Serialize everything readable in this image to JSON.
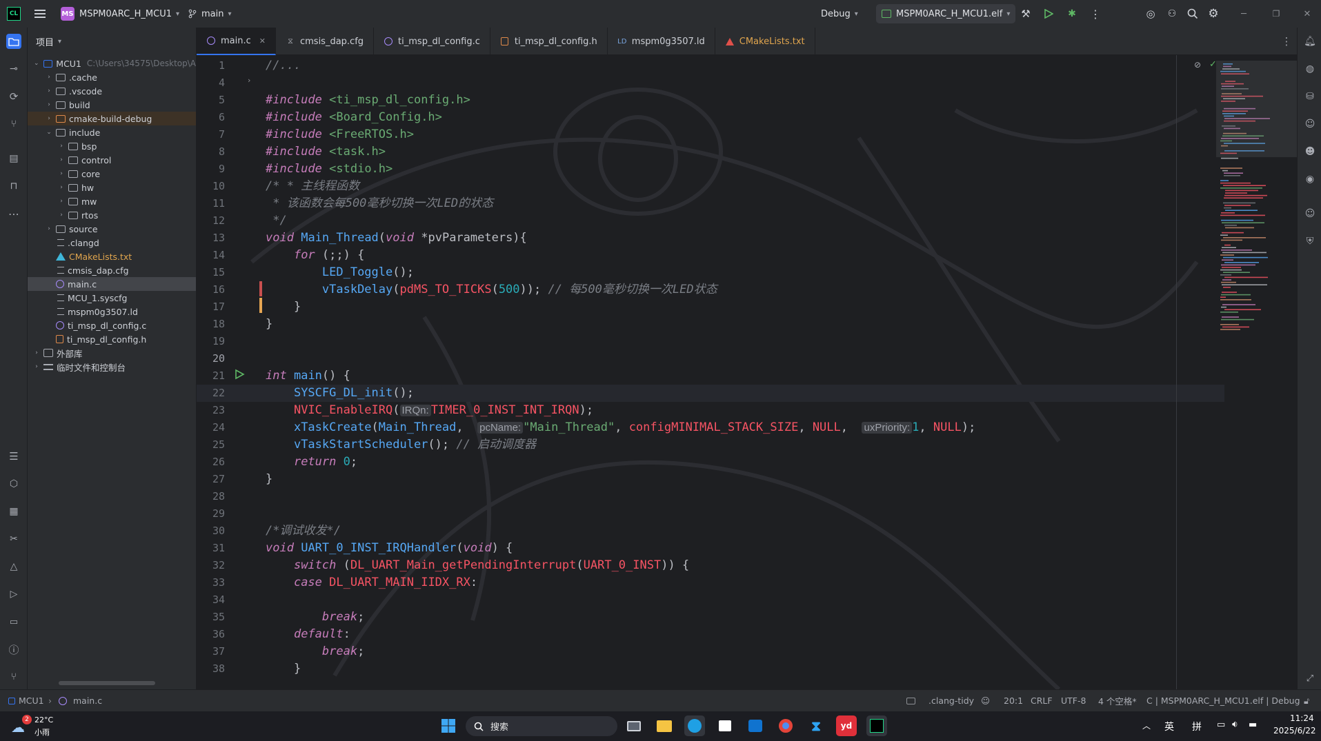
{
  "titlebar": {
    "project_badge": "MS",
    "project_name": "MSPM0ARC_H_MCU1",
    "branch": "main",
    "config": "Debug",
    "run_target": "MSPM0ARC_H_MCU1.elf"
  },
  "project_panel": {
    "title": "项目",
    "root_name": "MCU1",
    "root_path": "C:\\Users\\34575\\Desktop\\A",
    "items": [
      {
        "label": ".cache",
        "type": "folder",
        "depth": 1
      },
      {
        "label": ".vscode",
        "type": "folder",
        "depth": 1
      },
      {
        "label": "build",
        "type": "folder",
        "depth": 1
      },
      {
        "label": "cmake-build-debug",
        "type": "folder",
        "depth": 1
      },
      {
        "label": "include",
        "type": "folder",
        "depth": 1,
        "expanded": true
      },
      {
        "label": "bsp",
        "type": "folder",
        "depth": 2
      },
      {
        "label": "control",
        "type": "folder",
        "depth": 2
      },
      {
        "label": "core",
        "type": "folder",
        "depth": 2
      },
      {
        "label": "hw",
        "type": "folder",
        "depth": 2
      },
      {
        "label": "mw",
        "type": "folder",
        "depth": 2
      },
      {
        "label": "rtos",
        "type": "folder",
        "depth": 2
      },
      {
        "label": "source",
        "type": "folder",
        "depth": 1
      },
      {
        "label": ".clangd",
        "type": "file",
        "depth": 1
      },
      {
        "label": "CMakeLists.txt",
        "type": "cmake",
        "depth": 1
      },
      {
        "label": "cmsis_dap.cfg",
        "type": "file",
        "depth": 1
      },
      {
        "label": "main.c",
        "type": "c",
        "depth": 1
      },
      {
        "label": "MCU_1.syscfg",
        "type": "file",
        "depth": 1
      },
      {
        "label": "mspm0g3507.ld",
        "type": "file",
        "depth": 1
      },
      {
        "label": "ti_msp_dl_config.c",
        "type": "c",
        "depth": 1
      },
      {
        "label": "ti_msp_dl_config.h",
        "type": "h",
        "depth": 1
      },
      {
        "label": "外部库",
        "type": "lib",
        "depth": 0
      },
      {
        "label": "临时文件和控制台",
        "type": "scratch",
        "depth": 0
      }
    ]
  },
  "tabs": [
    {
      "label": "main.c",
      "active": true
    },
    {
      "label": "cmsis_dap.cfg"
    },
    {
      "label": "ti_msp_dl_config.c"
    },
    {
      "label": "ti_msp_dl_config.h"
    },
    {
      "label": "mspm0g3507.ld"
    },
    {
      "label": "CMakeLists.txt"
    }
  ],
  "line_numbers": [
    "1",
    "4",
    "5",
    "6",
    "7",
    "8",
    "9",
    "10",
    "11",
    "12",
    "13",
    "14",
    "15",
    "16",
    "17",
    "18",
    "19",
    "20",
    "21",
    "22",
    "23",
    "24",
    "25",
    "26",
    "27",
    "28",
    "29",
    "30",
    "31",
    "32",
    "33",
    "34",
    "35",
    "36",
    "37",
    "38"
  ],
  "code": {
    "l1": "//...",
    "inc": "#include",
    "inc1": "<ti_msp_dl_config.h>",
    "inc2": "<Board_Config.h>",
    "inc3": "<FreeRTOS.h>",
    "inc4": "<task.h>",
    "inc5": "<stdio.h>",
    "cm1": "/* * 主线程函数",
    "cm2": " * 该函数会每500毫秒切换一次LED的状态",
    "cm3": " */",
    "void": "void",
    "main_thread": "Main_Thread",
    "pvparam": "*pvParameters){",
    "for": "for",
    "for_rest": " (;;) {",
    "led": "LED_Toggle",
    "vdelay": "vTaskDelay",
    "pdms": "pdMS_TO_TICKS",
    "n500": "500",
    "cm4": "// 每500毫秒切换一次LED状态",
    "int": "int",
    "main": "main",
    "sysinit": "SYSCFG_DL_init",
    "nvic": "NVIC_EnableIRQ",
    "hint_irqn": "IRQn:",
    "timer_irq": "TIMER_0_INST_INT_IRQN",
    "xcreate": "xTaskCreate",
    "hint_pcname": "pcName:",
    "str_main": "\"Main_Thread\"",
    "cfg_stack": "configMINIMAL_STACK_SIZE",
    "null": "NULL",
    "hint_prio": "uxPriority:",
    "n1": "1",
    "vstart": "vTaskStartScheduler",
    "cm5": "// 启动调度器",
    "return": "return",
    "n0": "0",
    "cm6": "/*调试收发*/",
    "uart_handler": "UART_0_INST_IRQHandler",
    "switch": "switch",
    "getpending": "DL_UART_Main_getPendingInterrupt",
    "uart_inst": "UART_0_INST",
    "case": "case",
    "iidx": "DL_UART_MAIN_IIDX_RX",
    "break": "break",
    "default": "default"
  },
  "status": {
    "crumb1": "MCU1",
    "crumb2": "main.c",
    "linter": ".clang-tidy",
    "position": "20:1",
    "line_sep": "CRLF",
    "encoding": "UTF-8",
    "indent": "4 个空格*",
    "context": "C | MSPM0ARC_H_MCU1.elf | Debug"
  },
  "taskbar": {
    "weather_badge": "2",
    "temp": "22°C",
    "weather": "小雨",
    "search": "搜索",
    "ime1": "英",
    "ime2": "拼",
    "time": "11:24",
    "date": "2025/6/22"
  },
  "colors": {
    "accent": "#3574f0",
    "bg": "#1e1f22",
    "panel": "#2b2d30"
  }
}
